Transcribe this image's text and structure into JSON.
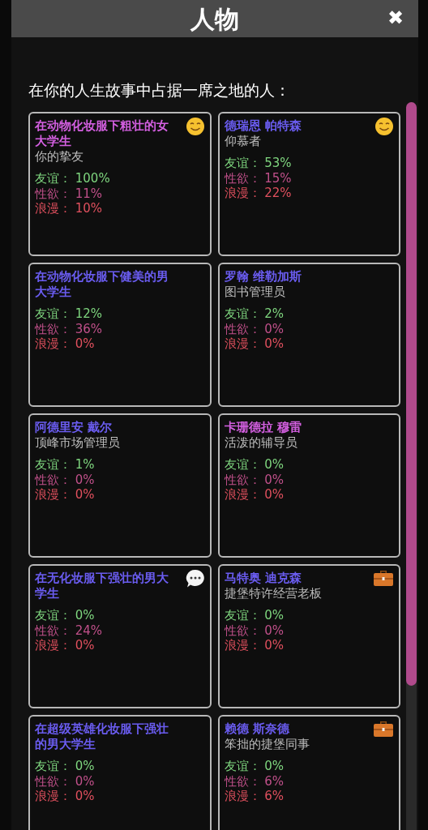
{
  "window": {
    "title": "人物",
    "close": "✖"
  },
  "intro": "在你的人生故事中占据一席之地的人：",
  "people": [
    {
      "name": "在动物化妆服下粗壮的女大学生",
      "color": "#d35fe0",
      "role": "你的挚友",
      "kind": "smile",
      "stats": [
        {
          "kind": "friendship",
          "label": "友谊：",
          "value": "100%"
        },
        {
          "kind": "lust",
          "label": "性欲：",
          "value": "11%"
        },
        {
          "kind": "romance",
          "label": "浪漫：",
          "value": "10%"
        }
      ]
    },
    {
      "name": "德瑞恩 帕特森",
      "color": "#6a5cf0",
      "role": "仰慕者",
      "kind": "smile",
      "stats": [
        {
          "kind": "friendship",
          "label": "友谊：",
          "value": "53%"
        },
        {
          "kind": "lust",
          "label": "性欲：",
          "value": "15%"
        },
        {
          "kind": "romance",
          "label": "浪漫：",
          "value": "22%"
        }
      ]
    },
    {
      "name": "在动物化妆服下健美的男大学生",
      "color": "#6a5cf0",
      "kind": "plain",
      "stats": [
        {
          "kind": "friendship",
          "label": "友谊：",
          "value": "12%"
        },
        {
          "kind": "lust",
          "label": "性欲：",
          "value": "36%"
        },
        {
          "kind": "romance",
          "label": "浪漫：",
          "value": "0%"
        }
      ]
    },
    {
      "name": "罗翰 维勒加斯",
      "color": "#6a5cf0",
      "role": "图书管理员",
      "kind": "plain",
      "stats": [
        {
          "kind": "friendship",
          "label": "友谊：",
          "value": "2%"
        },
        {
          "kind": "lust",
          "label": "性欲：",
          "value": "0%"
        },
        {
          "kind": "romance",
          "label": "浪漫：",
          "value": "0%"
        }
      ]
    },
    {
      "name": "阿德里安 戴尔",
      "color": "#6a5cf0",
      "role": "顶峰市场管理员",
      "kind": "plain",
      "stats": [
        {
          "kind": "friendship",
          "label": "友谊：",
          "value": "1%"
        },
        {
          "kind": "lust",
          "label": "性欲：",
          "value": "0%"
        },
        {
          "kind": "romance",
          "label": "浪漫：",
          "value": "0%"
        }
      ]
    },
    {
      "name": "卡珊德拉 穆雷",
      "color": "#d35fe0",
      "role": "活泼的辅导员",
      "kind": "plain",
      "stats": [
        {
          "kind": "friendship",
          "label": "友谊：",
          "value": "0%"
        },
        {
          "kind": "lust",
          "label": "性欲：",
          "value": "0%"
        },
        {
          "kind": "romance",
          "label": "浪漫：",
          "value": "0%"
        }
      ]
    },
    {
      "name": "在无化妆服下强壮的男大学生",
      "color": "#6a5cf0",
      "kind": "chat",
      "stats": [
        {
          "kind": "friendship",
          "label": "友谊：",
          "value": "0%"
        },
        {
          "kind": "lust",
          "label": "性欲：",
          "value": "24%"
        },
        {
          "kind": "romance",
          "label": "浪漫：",
          "value": "0%"
        }
      ]
    },
    {
      "name": "马特奥 迪克森",
      "color": "#6a5cf0",
      "role": "捷堡特许经营老板",
      "kind": "work",
      "stats": [
        {
          "kind": "friendship",
          "label": "友谊：",
          "value": "0%"
        },
        {
          "kind": "lust",
          "label": "性欲：",
          "value": "0%"
        },
        {
          "kind": "romance",
          "label": "浪漫：",
          "value": "0%"
        }
      ]
    },
    {
      "name": "在超级英雄化妆服下强壮的男大学生",
      "color": "#6a5cf0",
      "kind": "plain",
      "stats": [
        {
          "kind": "friendship",
          "label": "友谊：",
          "value": "0%"
        },
        {
          "kind": "lust",
          "label": "性欲：",
          "value": "0%"
        },
        {
          "kind": "romance",
          "label": "浪漫：",
          "value": "0%"
        }
      ]
    },
    {
      "name": "赖德 斯奈德",
      "color": "#6a5cf0",
      "role": "笨拙的捷堡同事",
      "kind": "work",
      "stats": [
        {
          "kind": "friendship",
          "label": "友谊：",
          "value": "0%"
        },
        {
          "kind": "lust",
          "label": "性欲：",
          "value": "6%"
        },
        {
          "kind": "romance",
          "label": "浪漫：",
          "value": "6%"
        }
      ]
    }
  ]
}
